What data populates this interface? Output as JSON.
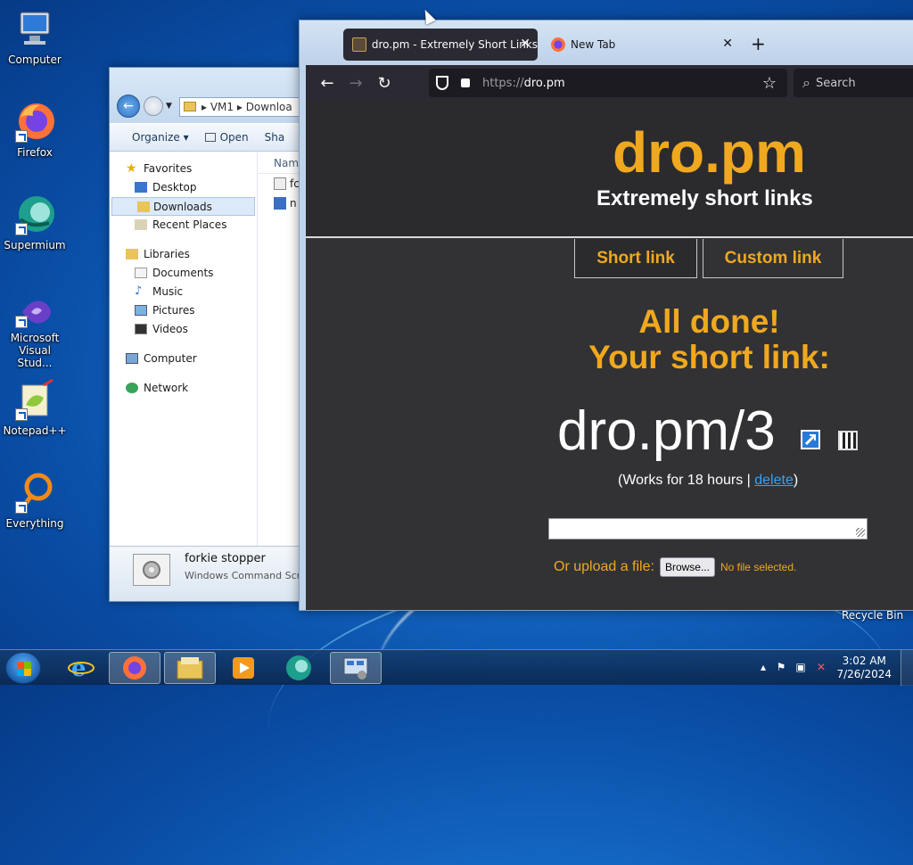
{
  "desktop": {
    "icons": [
      {
        "label": "Computer",
        "icon": "computer-icon"
      },
      {
        "label": "Firefox",
        "icon": "firefox-icon"
      },
      {
        "label": "Supermium",
        "icon": "supermium-icon"
      },
      {
        "label": "Microsoft Visual Stud...",
        "icon": "visual-studio-icon"
      },
      {
        "label": "Notepad++",
        "icon": "notepadpp-icon"
      },
      {
        "label": "Everything",
        "icon": "everything-icon"
      }
    ],
    "recycle_bin_label": "Recycle Bin"
  },
  "explorer": {
    "address": "▸ VM1 ▸ Downloa",
    "toolbar": {
      "organize": "Organize ▾",
      "open": "Open",
      "share": "Sha"
    },
    "nav": {
      "favorites": "Favorites",
      "desktop": "Desktop",
      "downloads": "Downloads",
      "recent_places": "Recent Places",
      "libraries": "Libraries",
      "documents": "Documents",
      "music": "Music",
      "pictures": "Pictures",
      "videos": "Videos",
      "computer": "Computer",
      "network": "Network"
    },
    "files_header": "Nam",
    "files": [
      {
        "name": "fc"
      },
      {
        "name": "n"
      }
    ],
    "details": {
      "name": "forkie stopper",
      "type": "Windows Command Scr"
    }
  },
  "firefox": {
    "tabs": [
      {
        "title": "dro.pm - Extremely Short Links",
        "close": "✕"
      },
      {
        "title": "New Tab",
        "close": "✕"
      }
    ],
    "new_tab_symbol": "+",
    "url": {
      "protocol": "https://",
      "host": "dro.pm"
    },
    "search_placeholder": "Search",
    "icons": {
      "back": "←",
      "forward": "→",
      "reload": "↻",
      "bookmark": "☆",
      "search": "⌕"
    }
  },
  "site": {
    "logo": "dro.pm",
    "tagline": "Extremely short links",
    "tabs": {
      "short": "Short link",
      "custom": "Custom link"
    },
    "done_line1": "All done!",
    "done_line2": "Your short link:",
    "short_link": "dro.pm/3",
    "works_prefix": "(Works for 18 hours | ",
    "delete": "delete",
    "works_suffix": ")",
    "upload_label": "Or upload a file:",
    "browse": "Browse...",
    "no_file": "No file selected.",
    "colors": {
      "accent": "#f0a81e",
      "background": "#323235",
      "link": "#3aa0f0"
    }
  },
  "taskbar": {
    "clock_time": "3:02 AM",
    "clock_date": "7/26/2024",
    "apps": [
      "internet-explorer-icon",
      "firefox-icon",
      "file-explorer-icon",
      "media-player-icon",
      "supermium-icon",
      "network-settings-icon"
    ]
  }
}
